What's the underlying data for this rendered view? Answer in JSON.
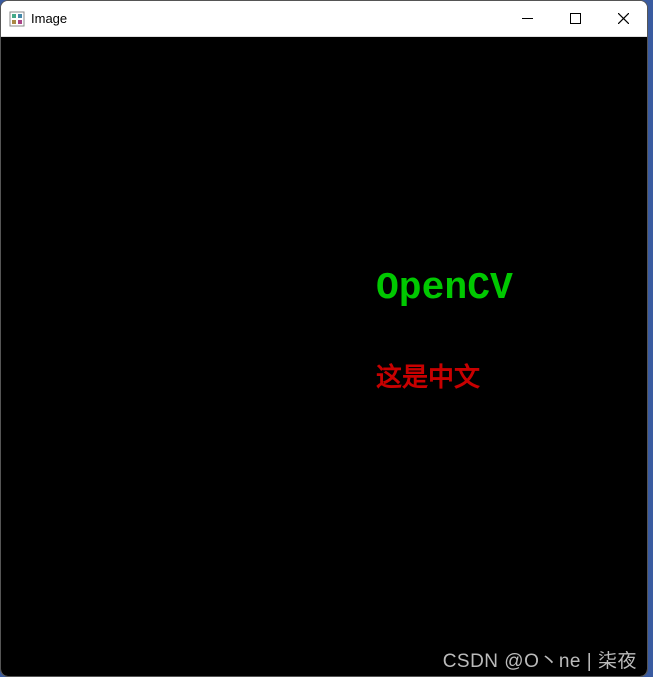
{
  "window": {
    "title": "Image"
  },
  "canvas": {
    "text1": "OpenCV",
    "text2": "这是中文"
  },
  "watermark": {
    "text": "CSDN @O丶ne | 柒夜"
  }
}
